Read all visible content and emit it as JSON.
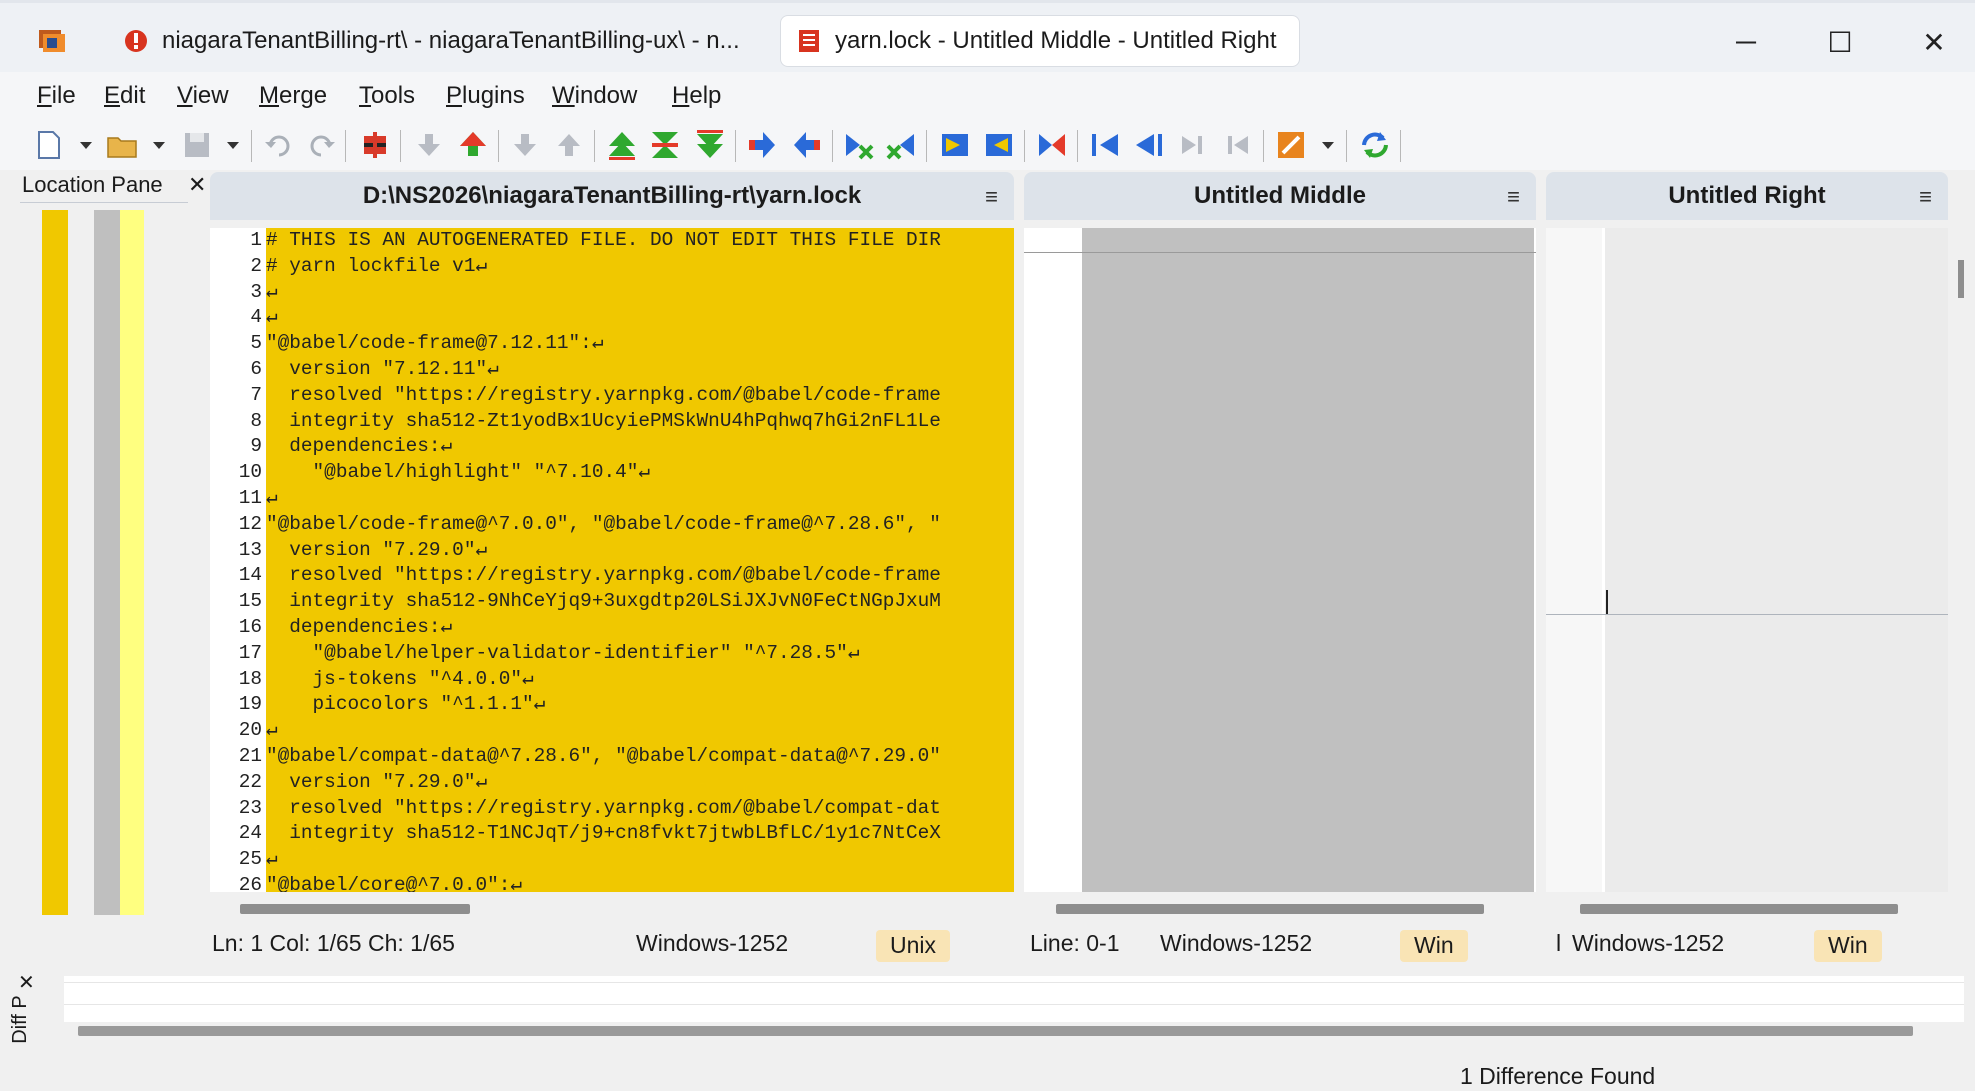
{
  "window": {
    "tabs": [
      {
        "label": "niagaraTenantBilling-rt\\ - niagaraTenantBilling-ux\\ - n..."
      },
      {
        "label": "yarn.lock - Untitled Middle - Untitled Right"
      }
    ],
    "controls": {
      "minimize": "─",
      "maximize": "☐",
      "close": "✕"
    }
  },
  "menu": [
    {
      "u": "F",
      "rest": "ile"
    },
    {
      "u": "E",
      "rest": "dit"
    },
    {
      "u": "V",
      "rest": "iew"
    },
    {
      "u": "M",
      "rest": "erge"
    },
    {
      "u": "T",
      "rest": "ools"
    },
    {
      "u": "P",
      "rest": "lugins"
    },
    {
      "u": "W",
      "rest": "indow"
    },
    {
      "u": "H",
      "rest": "elp"
    }
  ],
  "location_pane": {
    "title": "Location Pane",
    "close": "✕"
  },
  "panels": {
    "left": {
      "title": "D:\\NS2026\\niagaraTenantBilling-rt\\yarn.lock",
      "menu_icon": "≡"
    },
    "middle": {
      "title": "Untitled Middle",
      "menu_icon": "≡"
    },
    "right": {
      "title": "Untitled Right",
      "menu_icon": "≡"
    }
  },
  "code_lines": [
    {
      "n": "1",
      "t": "# THIS IS AN AUTOGENERATED FILE. DO NOT EDIT THIS FILE DIR"
    },
    {
      "n": "2",
      "t": "# yarn lockfile v1↵"
    },
    {
      "n": "3",
      "t": "↵"
    },
    {
      "n": "4",
      "t": "↵"
    },
    {
      "n": "5",
      "t": "\"@babel/code-frame@7.12.11\":↵"
    },
    {
      "n": "6",
      "t": "  version \"7.12.11\"↵"
    },
    {
      "n": "7",
      "t": "  resolved \"https://registry.yarnpkg.com/@babel/code-frame"
    },
    {
      "n": "8",
      "t": "  integrity sha512-Zt1yodBx1UcyiePMSkWnU4hPqhwq7hGi2nFL1Le"
    },
    {
      "n": "9",
      "t": "  dependencies:↵"
    },
    {
      "n": "10",
      "t": "    \"@babel/highlight\" \"^7.10.4\"↵"
    },
    {
      "n": "11",
      "t": "↵"
    },
    {
      "n": "12",
      "t": "\"@babel/code-frame@^7.0.0\", \"@babel/code-frame@^7.28.6\", \""
    },
    {
      "n": "13",
      "t": "  version \"7.29.0\"↵"
    },
    {
      "n": "14",
      "t": "  resolved \"https://registry.yarnpkg.com/@babel/code-frame"
    },
    {
      "n": "15",
      "t": "  integrity sha512-9NhCeYjq9+3uxgdtp20LSiJXJvN0FeCtNGpJxuM"
    },
    {
      "n": "16",
      "t": "  dependencies:↵"
    },
    {
      "n": "17",
      "t": "    \"@babel/helper-validator-identifier\" \"^7.28.5\"↵"
    },
    {
      "n": "18",
      "t": "    js-tokens \"^4.0.0\"↵"
    },
    {
      "n": "19",
      "t": "    picocolors \"^1.1.1\"↵"
    },
    {
      "n": "20",
      "t": "↵"
    },
    {
      "n": "21",
      "t": "\"@babel/compat-data@^7.28.6\", \"@babel/compat-data@^7.29.0\""
    },
    {
      "n": "22",
      "t": "  version \"7.29.0\"↵"
    },
    {
      "n": "23",
      "t": "  resolved \"https://registry.yarnpkg.com/@babel/compat-dat"
    },
    {
      "n": "24",
      "t": "  integrity sha512-T1NCJqT/j9+cn8fvkt7jtwbLBfLC/1y1c7NtCeX"
    },
    {
      "n": "25",
      "t": "↵"
    },
    {
      "n": "26",
      "t": "\"@babel/core@^7.0.0\":↵"
    }
  ],
  "status": {
    "left": {
      "pos": "Ln: 1  Col: 1/65  Ch: 1/65",
      "encoding": "Windows-1252",
      "eol": "Unix"
    },
    "middle": {
      "pos": "Line: 0-1",
      "encoding": "Windows-1252",
      "eol": "Win"
    },
    "right": {
      "pos": "l",
      "encoding": "Windows-1252",
      "eol": "Win"
    }
  },
  "diff_pane": {
    "title": "Diff P",
    "close": "✕"
  },
  "statusbar": {
    "message": "1 Difference Found"
  },
  "colors": {
    "diff_yellow": "#f0c800",
    "light_yellow": "#ffff80",
    "gray": "#c0c0c0",
    "header_bg": "#dde3ea",
    "badge_bg": "#f9e4b5"
  }
}
